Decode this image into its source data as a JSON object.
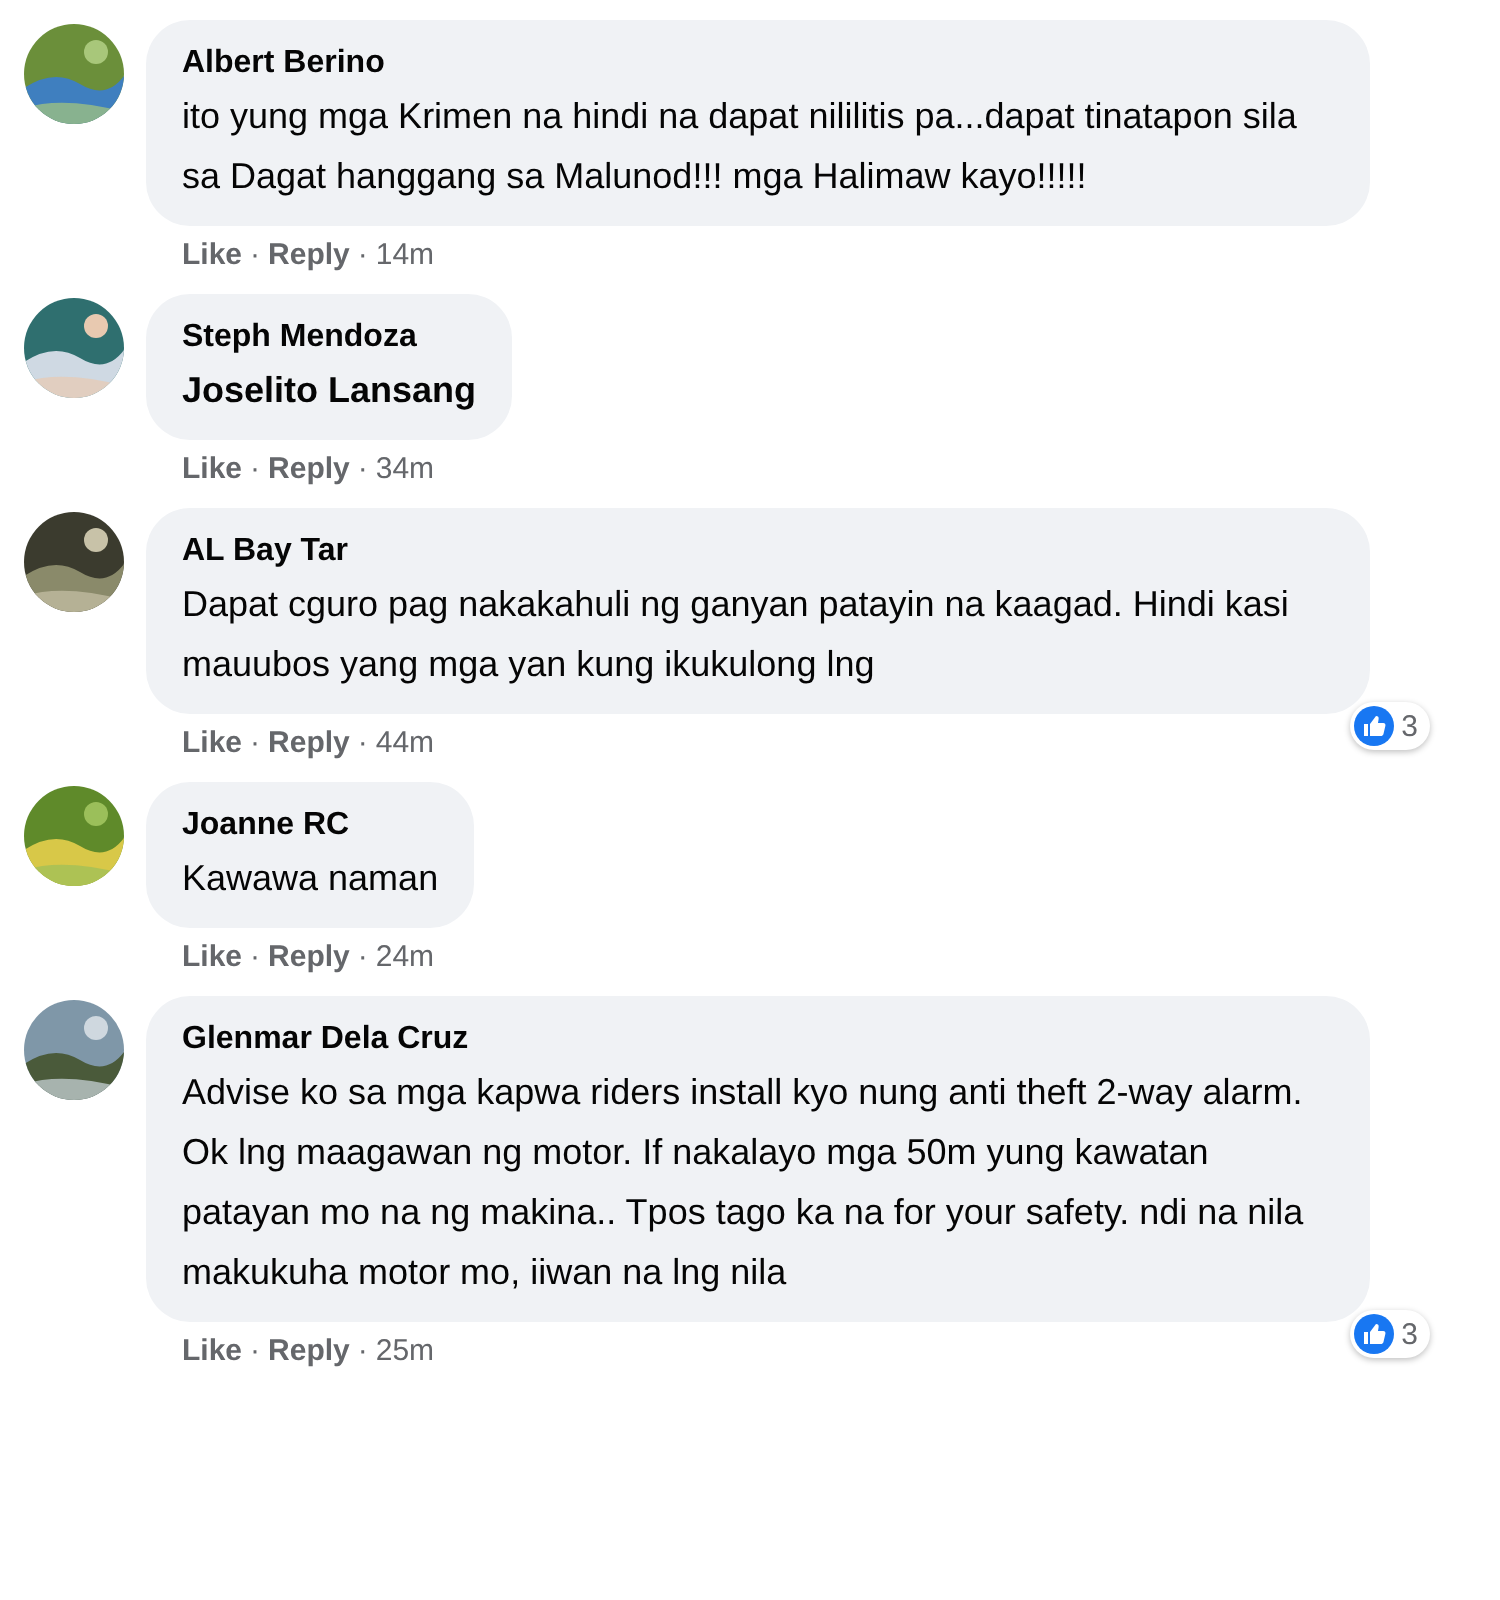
{
  "separator": "·",
  "comments": [
    {
      "author": "Albert Berino",
      "text": "ito yung mga Krimen na hindi na dapat nililitis pa...dapat tinatapon sila sa Dagat hanggang sa Malunod!!! mga Halimaw kayo!!!!!",
      "mention": false,
      "actions": [
        "Like",
        "Reply"
      ],
      "time": "14m"
    },
    {
      "author": "Steph Mendoza",
      "text": "Joselito Lansang",
      "mention": true,
      "actions": [
        "Like",
        "Reply"
      ],
      "time": "34m"
    },
    {
      "author": "AL Bay Tar",
      "text": "Dapat cguro pag nakakahuli ng ganyan patayin na kaagad. Hindi kasi mauubos yang mga yan kung ikukulong lng",
      "mention": false,
      "actions": [
        "Like",
        "Reply"
      ],
      "time": "44m",
      "reactions": "3"
    },
    {
      "author": "Joanne RC",
      "text": "Kawawa naman",
      "mention": false,
      "actions": [
        "Like",
        "Reply"
      ],
      "time": "24m"
    },
    {
      "author": "Glenmar Dela Cruz",
      "text": "Advise ko sa mga kapwa riders install kyo nung anti theft 2-way alarm. Ok lng maagawan ng motor. If nakalayo mga 50m yung kawatan patayan mo na ng makina.. Tpos tago ka na for your safety. ndi na nila makukuha motor mo, iiwan na lng nila",
      "mention": false,
      "actions": [
        "Like",
        "Reply"
      ],
      "time": "25m",
      "reactions": "3"
    }
  ]
}
